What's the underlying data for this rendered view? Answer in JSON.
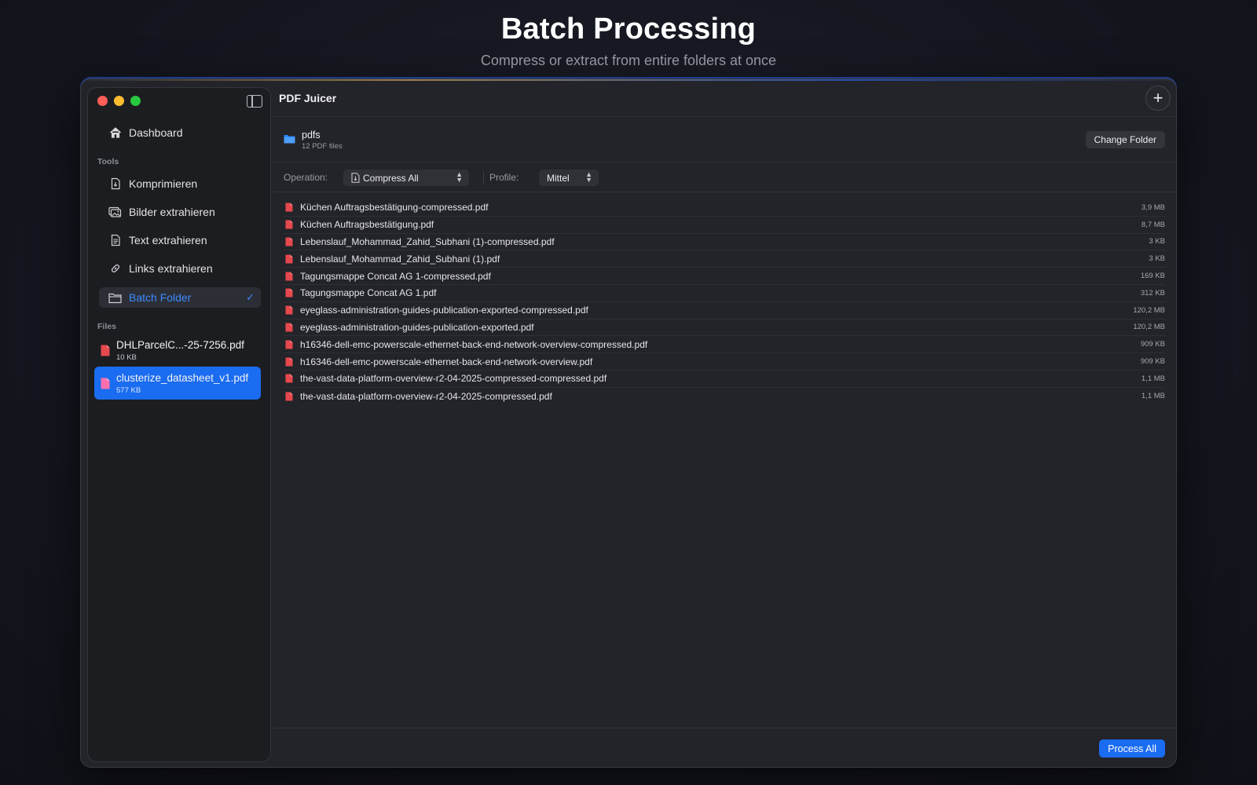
{
  "hero": {
    "title": "Batch Processing",
    "subtitle": "Compress or extract from entire folders at once"
  },
  "sidebar": {
    "dashboard_label": "Dashboard",
    "tools_label": "Tools",
    "tools": [
      {
        "label": "Komprimieren",
        "icon": "compress-doc-icon"
      },
      {
        "label": "Bilder extrahieren",
        "icon": "images-icon"
      },
      {
        "label": "Text extrahieren",
        "icon": "text-doc-icon"
      },
      {
        "label": "Links extrahieren",
        "icon": "link-icon"
      },
      {
        "label": "Batch Folder",
        "icon": "folder-icon",
        "active": true
      }
    ],
    "files_label": "Files",
    "files": [
      {
        "name": "DHLParcelC...-25-7256.pdf",
        "size": "10 KB"
      },
      {
        "name": "clusterize_datasheet_v1.pdf",
        "size": "577 KB",
        "selected": true
      }
    ]
  },
  "main": {
    "app_title": "PDF Juicer",
    "folder": {
      "name": "pdfs",
      "count": "12 PDF files"
    },
    "change_folder_label": "Change Folder",
    "operation_label": "Operation:",
    "operation_value": "Compress All",
    "profile_label": "Profile:",
    "profile_value": "Mittel",
    "files": [
      {
        "name": "Küchen Auftragsbestätigung-compressed.pdf",
        "size": "3,9 MB"
      },
      {
        "name": "Küchen Auftragsbestätigung.pdf",
        "size": "8,7 MB"
      },
      {
        "name": "Lebenslauf_Mohammad_Zahid_Subhani (1)-compressed.pdf",
        "size": "3 KB"
      },
      {
        "name": "Lebenslauf_Mohammad_Zahid_Subhani (1).pdf",
        "size": "3 KB"
      },
      {
        "name": "Tagungsmappe Concat AG 1-compressed.pdf",
        "size": "169 KB"
      },
      {
        "name": "Tagungsmappe Concat AG 1.pdf",
        "size": "312 KB"
      },
      {
        "name": "eyeglass-administration-guides-publication-exported-compressed.pdf",
        "size": "120,2 MB"
      },
      {
        "name": "eyeglass-administration-guides-publication-exported.pdf",
        "size": "120,2 MB"
      },
      {
        "name": "h16346-dell-emc-powerscale-ethernet-back-end-network-overview-compressed.pdf",
        "size": "909 KB"
      },
      {
        "name": "h16346-dell-emc-powerscale-ethernet-back-end-network-overview.pdf",
        "size": "909 KB"
      },
      {
        "name": "the-vast-data-platform-overview-r2-04-2025-compressed-compressed.pdf",
        "size": "1,1 MB"
      },
      {
        "name": "the-vast-data-platform-overview-r2-04-2025-compressed.pdf",
        "size": "1,1 MB"
      }
    ],
    "process_all_label": "Process All"
  },
  "colors": {
    "accent": "#1a6cf0",
    "active_text": "#3a8bff",
    "pdf_icon": "#e5484d",
    "selected_file_icon": "#ff6fae"
  }
}
